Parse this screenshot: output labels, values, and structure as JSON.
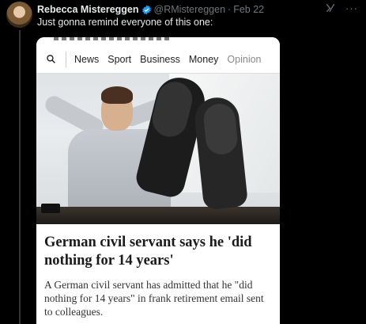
{
  "tweet": {
    "author_name": "Rebecca Mistereggen",
    "author_handle": "@RMistereggen",
    "separator": "·",
    "date": "Feb 22",
    "text": "Just gonna remind everyone of this one:",
    "more_label": "···"
  },
  "article": {
    "nav_items": [
      "News",
      "Sport",
      "Business",
      "Money",
      "Opinion"
    ],
    "headline": "German civil servant says he 'did nothing for 14 years'",
    "standfirst": "A German civil servant has admitted that he \"did nothing for 14 years\" in frank retirement email sent to colleagues."
  },
  "icons": {
    "verified": "verified-badge-icon",
    "grok": "grok-icon",
    "more": "more-icon",
    "search": "search-icon"
  },
  "colors": {
    "background": "#000000",
    "text_primary": "#e7e9ea",
    "text_secondary": "#71767b",
    "verified_blue": "#1d9bf0"
  }
}
